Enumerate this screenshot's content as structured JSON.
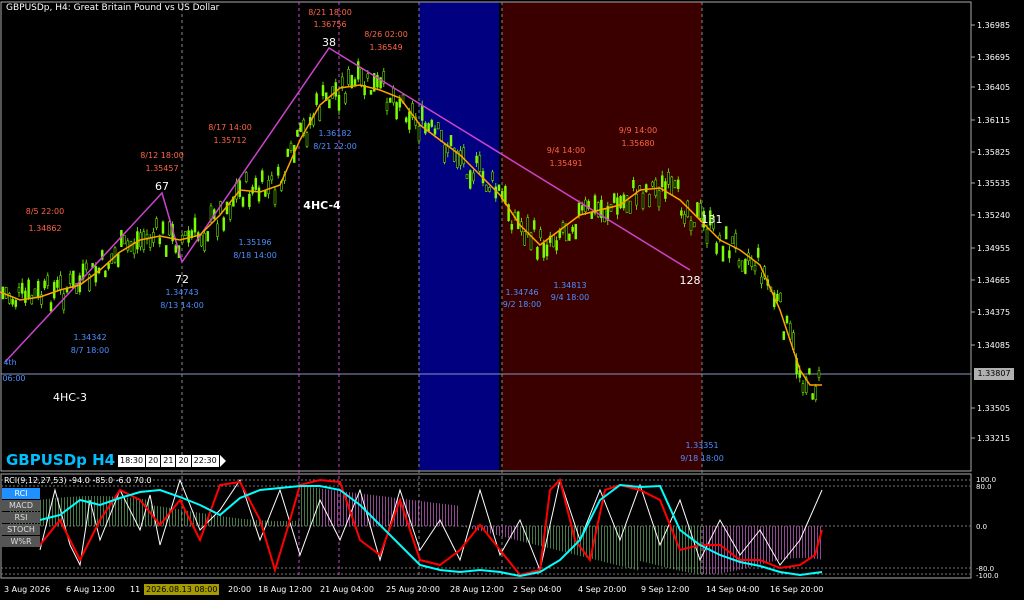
{
  "header": {
    "symbol_title": "GBPUSDp, H4:  Great Britain Pound vs US Dollar",
    "big_symbol": "GBPUSDp H4"
  },
  "timeframe_buttons": [
    "18:30",
    "20",
    "21",
    "20",
    "22:30"
  ],
  "price_axis": [
    "1.36985",
    "1.36695",
    "1.36405",
    "1.36115",
    "1.35825",
    "1.35535",
    "1.35240",
    "1.34955",
    "1.34665",
    "1.34375",
    "1.34085",
    "1.33505",
    "1.33215"
  ],
  "current_price": "1.33807",
  "time_axis": [
    "3 Aug 2026",
    "6 Aug 12:00",
    "11",
    "20:00",
    "18 Aug 12:00",
    "21 Aug 04:00",
    "25 Aug 20:00",
    "28 Aug 12:00",
    "2 Sep 04:00",
    "4 Sep 20:00",
    "9 Sep 12:00",
    "14 Sep 04:00",
    "16 Sep 20:00"
  ],
  "selected_date": "2026.08.13 08:00",
  "wave_labels": {
    "p4th": "4th",
    "p67": "67",
    "p72": "72",
    "p38": "38",
    "p128": "128",
    "p131": "131",
    "hc3": "4HC-3",
    "hc4": "4HC-4",
    "hour0600": "06:00"
  },
  "annotations": {
    "a1_date": "8/5 22:00",
    "a1_price": "1.34862",
    "a2_date": "8/12 18:00",
    "a2_price": "1.35457",
    "a3_date": "8/17 14:00",
    "a3_price": "1.35712",
    "a4_date": "8/21 18:00",
    "a4_price": "1.36756",
    "a5_date": "8/26 02:00",
    "a5_price": "1.36549",
    "a6_date": "9/4 14:00",
    "a6_price": "1.35491",
    "a7_date": "9/9 14:00",
    "a7_price": "1.35680",
    "b1_price": "1.34342",
    "b1_date": "8/7 18:00",
    "b2_price": "1.34743",
    "b2_date": "8/13 14:00",
    "b3_price": "1.35196",
    "b3_date": "8/18 14:00",
    "b4_price": "1.36182",
    "b4_date": "8/21 22:00",
    "b5_price": "1.34746",
    "b5_date": "9/2 18:00",
    "b6_price": "1.34813",
    "b6_date": "9/4 18:00",
    "b7_price": "1.33351",
    "b7_date": "9/18 18:00"
  },
  "indicator": {
    "title": "RCI(9,12,27,53) -94.0 -85.0 -6.0 70.0",
    "buttons": [
      "RCI",
      "MACD",
      "RSI",
      "STOCH",
      "W%R"
    ],
    "active": "RCI",
    "levels": [
      "100.0",
      "80.0",
      "0.0",
      "-80.0",
      "-100.0"
    ]
  },
  "colors": {
    "annotation_high": "#ff6347",
    "annotation_low": "#4f8fff",
    "ma_line": "#ffa500",
    "wave_line": "#cc44cc",
    "candle": "#7cfc00",
    "zone_blue": "#000080",
    "zone_red": "#400000",
    "rci_red": "#ff0000",
    "rci_cyan": "#00ffff",
    "rci_white": "#ffffff"
  }
}
